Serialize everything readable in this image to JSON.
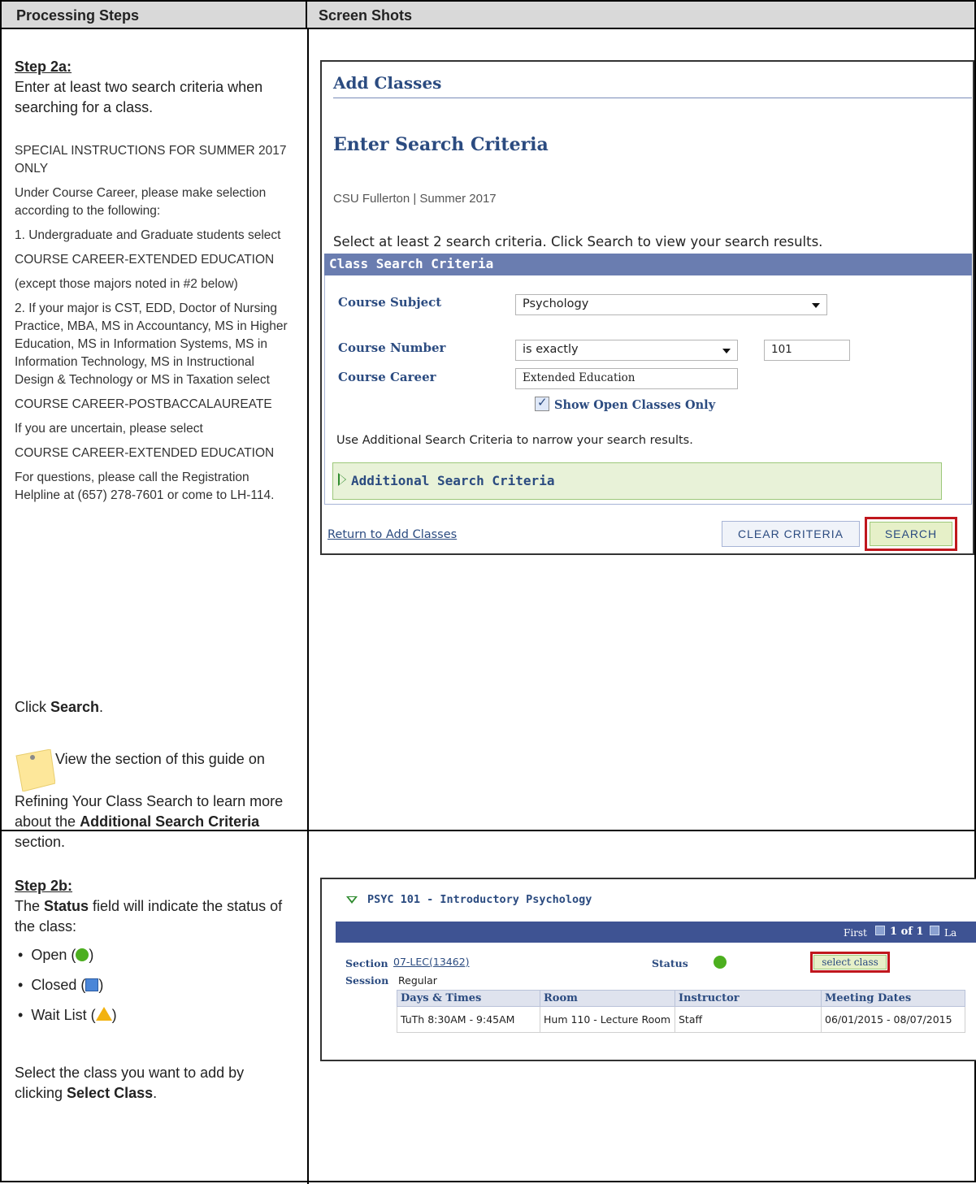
{
  "header": {
    "left": "Processing Steps",
    "right": "Screen Shots"
  },
  "step2a": {
    "title": "Step 2a:",
    "intro": "Enter at least two search criteria when searching for a class.",
    "special": [
      "SPECIAL INSTRUCTIONS FOR SUMMER 2017 ONLY",
      "Under Course Career, please make selection according to the following:",
      "1. Undergraduate and Graduate students select",
      "COURSE CAREER-EXTENDED EDUCATION",
      "(except those majors noted in #2 below)",
      "2. If your major is CST, EDD, Doctor of Nursing Practice, MBA, MS in Accountancy, MS in Higher Education, MS in Information Systems, MS in Information Technology, MS in Instructional Design & Technology or MS in Taxation select",
      "COURSE CAREER-POSTBACCALAUREATE",
      "If you are uncertain, please select",
      "COURSE CAREER-EXTENDED EDUCATION",
      "For questions, please call the Registration Helpline at (657) 278-7601 or come to LH-114."
    ],
    "click_prefix": "Click ",
    "click_bold": "Search",
    "click_suffix": ".",
    "note_text_1": "View the section of this guide on Refining Your Class Search to learn more about the ",
    "note_bold": "Additional Search Criteria",
    "note_text_2": " section."
  },
  "shot1": {
    "title": "Add Classes",
    "subtitle": "Enter Search Criteria",
    "term": "CSU Fullerton | Summer 2017",
    "instruction": "Select at least 2 search criteria. Click Search to view your search results.",
    "section_header": "Class Search Criteria",
    "course_subject_label": "Course Subject",
    "course_subject_value": "Psychology",
    "course_number_label": "Course Number",
    "course_number_op": "is exactly",
    "course_number_value": "101",
    "course_career_label": "Course Career",
    "course_career_value": "Extended Education",
    "open_only_label": "Show Open Classes Only",
    "additional_hint": "Use Additional Search Criteria to narrow your search results.",
    "additional_label": "Additional Search Criteria",
    "return_link": "Return to Add Classes",
    "clear_button": "Clear Criteria",
    "search_button": "Search"
  },
  "step2b": {
    "title": "Step 2b:",
    "line1_prefix": "The ",
    "line1_bold": "Status",
    "line1_suffix": " field will indicate the status of the class:",
    "bullets": [
      "Open (",
      "Closed (",
      "Wait List ("
    ],
    "bullet_close": ")",
    "select_prefix": "Select the class you want to add by clicking ",
    "select_bold": "Select Class",
    "select_suffix": "."
  },
  "shot2": {
    "course_title": "PSYC 101 - Introductory Psychology",
    "nav_first": "First",
    "nav_count": "1 of 1",
    "nav_last": "La",
    "section_label": "Section",
    "section_value": "07-LEC(13462)",
    "status_label": "Status",
    "select_button": "select class",
    "session_label": "Session",
    "session_value": "Regular",
    "columns": [
      "Days & Times",
      "Room",
      "Instructor",
      "Meeting Dates"
    ],
    "row": [
      "TuTh 8:30AM - 9:45AM",
      "Hum 110 - Lecture Room",
      "Staff",
      "06/01/2015 - 08/07/2015"
    ]
  },
  "colors": {
    "open": "#4caf1f",
    "closed": "#4a86d8",
    "waitlist": "#f2b20f",
    "highlight": "#c0171d",
    "ps_blue": "#2b4b80"
  }
}
